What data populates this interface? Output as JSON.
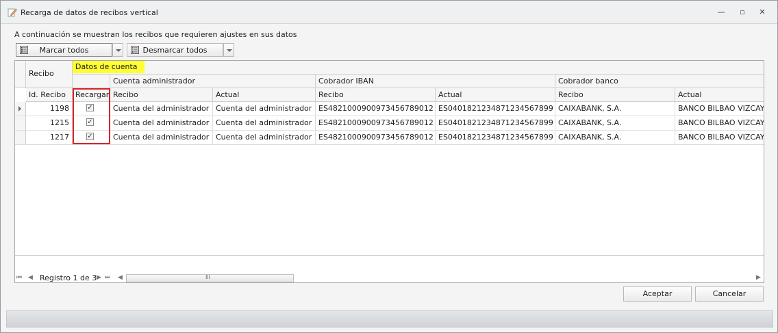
{
  "window": {
    "title": "Recarga de datos de recibos vertical",
    "minimize": "—",
    "maximize": "▫",
    "close": "✕"
  },
  "instruction": "A continuación se muestran los recibos que requieren ajustes en sus datos",
  "toolbar": {
    "select_all": "Marcar todos",
    "deselect_all": "Desmarcar todos"
  },
  "grid": {
    "band_recibo": "Recibo",
    "band_datos_cuenta": "Datos de cuenta",
    "band_cuenta_admin": "Cuenta administrador",
    "band_cobrador_iban": "Cobrador IBAN",
    "band_cobrador_banco": "Cobrador banco",
    "columns": [
      "Id. Recibo",
      "Recargar",
      "Recibo",
      "Actual",
      "Recibo",
      "Actual",
      "Recibo",
      "Actual"
    ],
    "rows": [
      {
        "id": "1198",
        "recargar": true,
        "admin_recibo": "Cuenta del administrador",
        "admin_actual": "Cuenta del administrador",
        "iban_recibo": "ES4821000900973456789012",
        "iban_actual": "ES0401821234871234567899",
        "banco_recibo": "CAIXABANK, S.A.",
        "banco_actual": "BANCO BILBAO VIZCAYA A"
      },
      {
        "id": "1215",
        "recargar": true,
        "admin_recibo": "Cuenta del administrador",
        "admin_actual": "Cuenta del administrador",
        "iban_recibo": "ES4821000900973456789012",
        "iban_actual": "ES0401821234871234567899",
        "banco_recibo": "CAIXABANK, S.A.",
        "banco_actual": "BANCO BILBAO VIZCAYA A"
      },
      {
        "id": "1217",
        "recargar": true,
        "admin_recibo": "Cuenta del administrador",
        "admin_actual": "Cuenta del administrador",
        "iban_recibo": "ES4821000900973456789012",
        "iban_actual": "ES0401821234871234567899",
        "banco_recibo": "CAIXABANK, S.A.",
        "banco_actual": "BANCO BILBAO VIZCAYA A"
      }
    ],
    "record_text": "Registro 1 de 3",
    "scroll_grip": "III"
  },
  "buttons": {
    "accept": "Aceptar",
    "cancel": "Cancelar"
  },
  "colors": {
    "highlight": "#ffff33",
    "selection_border": "#d9232b"
  },
  "icons": {
    "title": "pencil-document-icon",
    "list": "checklist-icon"
  }
}
